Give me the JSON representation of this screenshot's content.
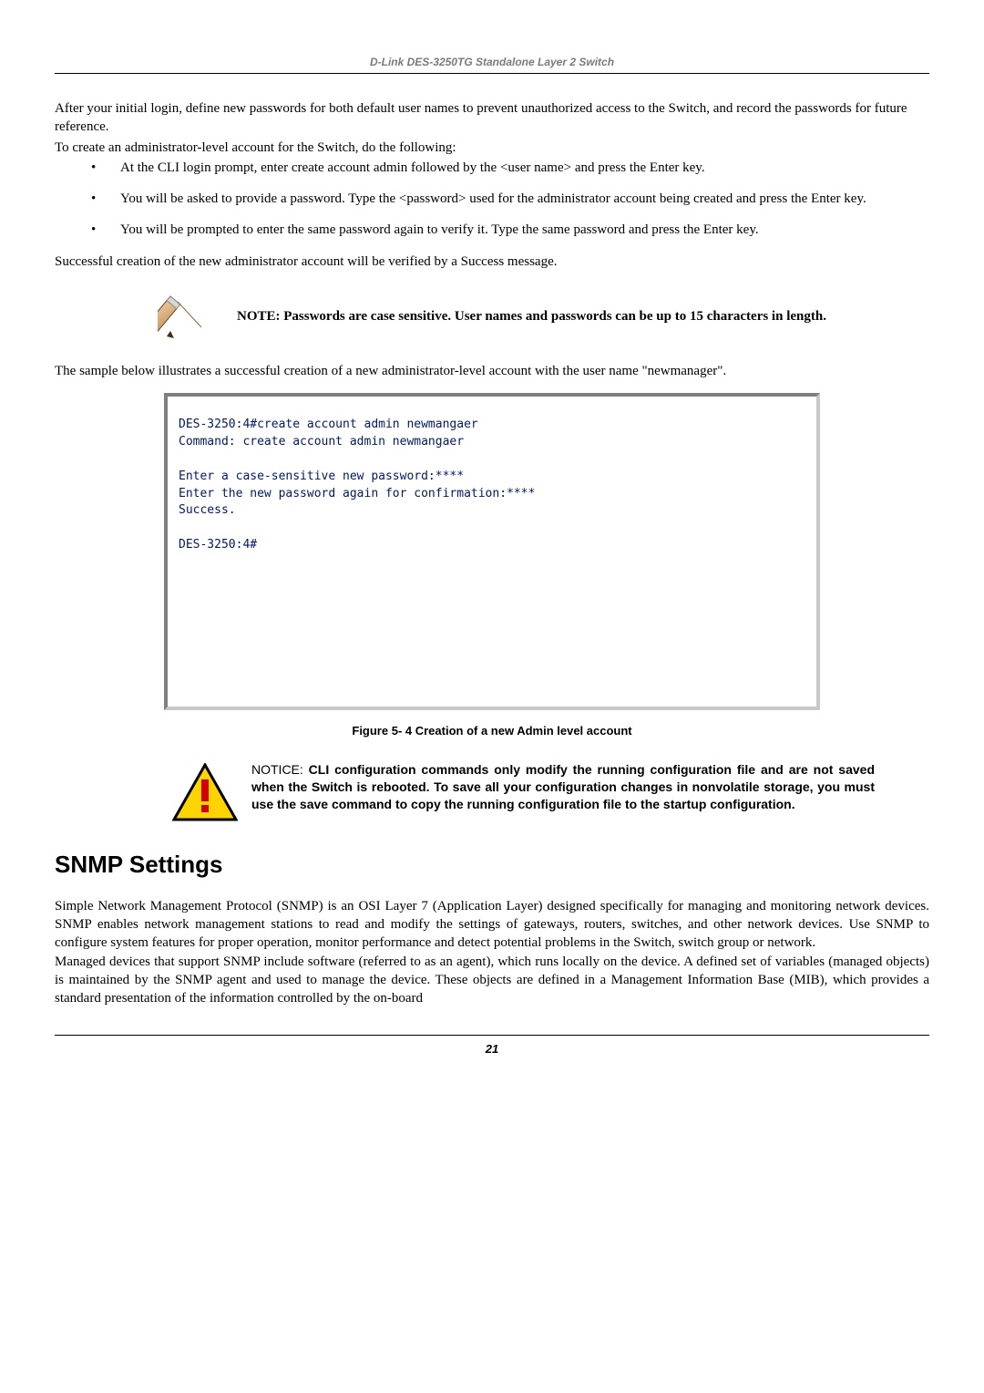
{
  "header": {
    "title": "D-Link DES-3250TG Standalone Layer 2 Switch"
  },
  "intro": {
    "p1": "After your initial login, define new passwords for both default user names to prevent unauthorized access to the Switch, and record the passwords for future reference.",
    "p2": "To create an administrator-level account for the Switch, do the following:"
  },
  "bullets": [
    "At the CLI login prompt, enter create account admin followed by the <user name> and press the Enter key.",
    "You will be asked to provide a password. Type the <password> used for the administrator account being created and press the Enter key.",
    "You will be prompted to enter the same password again to verify it. Type the same password and press the Enter key."
  ],
  "after_bullets": "Successful creation of the new administrator account will be verified by a Success message.",
  "note": {
    "text": "NOTE: Passwords are case sensitive. User names and passwords can be up to 15 characters in length."
  },
  "sample_intro": "The sample below illustrates a successful creation of a new administrator-level account with the user name \"newmanager\".",
  "cli_lines": [
    "DES-3250:4#create account admin newmangaer",
    "Command: create account admin newmangaer",
    "",
    "Enter a case-sensitive new password:****",
    "Enter the new password again for confirmation:****",
    "Success.",
    "",
    "DES-3250:4#"
  ],
  "figure_caption": "Figure 5- 4 Creation of a new Admin level account",
  "notice": {
    "lead": "NOTICE: ",
    "bold": "CLI configuration commands only modify the running configuration file and are not saved when the Switch is rebooted. To save all your configuration changes in nonvolatile storage, you must use the save command to copy the running configuration file to the startup configuration."
  },
  "snmp": {
    "heading": "SNMP Settings",
    "p1": "Simple Network Management Protocol (SNMP) is an OSI Layer 7 (Application Layer) designed specifically for managing and monitoring network devices. SNMP enables network management stations to read and modify the settings of gateways, routers, switches, and other network devices. Use SNMP to configure system features for proper operation, monitor performance and detect potential problems in the Switch, switch group or network.",
    "p2": "Managed devices that support SNMP include software (referred to as an agent), which runs locally on the device. A defined set of variables (managed objects) is maintained by the SNMP agent and used to manage the device. These objects are defined in a Management Information Base (MIB), which provides a standard presentation of the information controlled by the on-board"
  },
  "page_number": "21",
  "chart_data": null
}
